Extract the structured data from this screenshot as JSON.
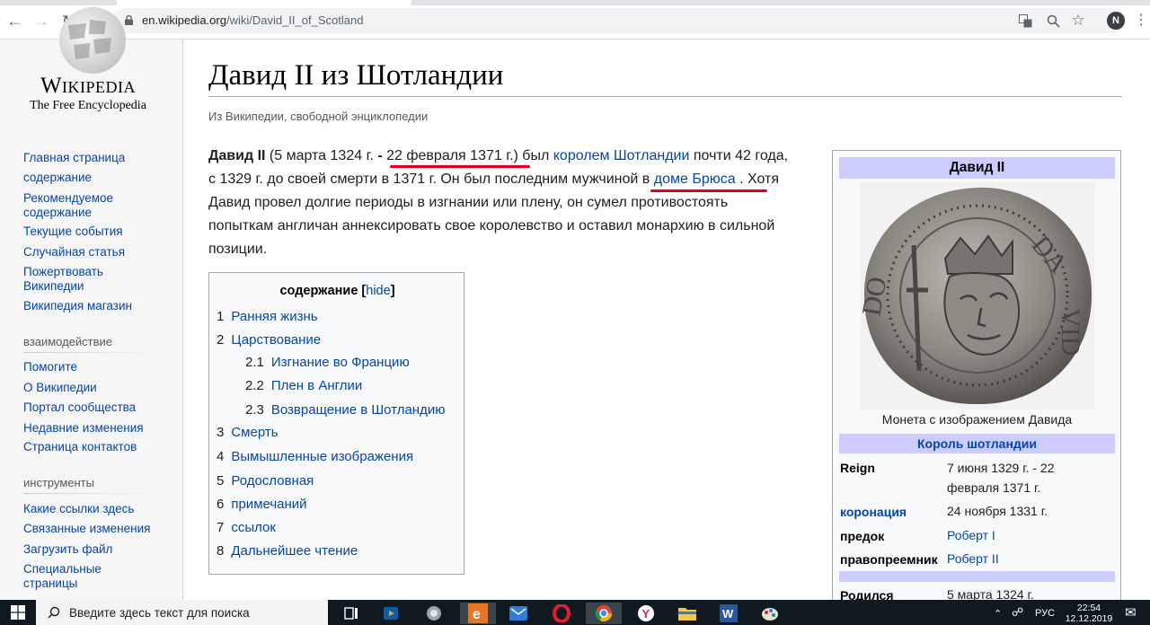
{
  "browser": {
    "url_host": "en.wikipedia.org",
    "url_path": "/wiki/David_II_of_Scotland",
    "profile_initial": "N"
  },
  "sidebar": {
    "logo_title": "Wikipedia",
    "logo_subtitle": "The Free Encyclopedia",
    "nav_links": [
      "Главная страница",
      "содержание",
      "Рекомендуемое содержание",
      "Текущие события",
      "Случайная статья",
      "Пожертвовать Википедии",
      "Википедия магазин"
    ],
    "interaction_heading": "взаимодействие",
    "interaction_links": [
      "Помогите",
      "О Википедии",
      "Портал сообщества",
      "Недавние изменения",
      "Страница контактов"
    ],
    "tools_heading": "инструменты",
    "tools_links": [
      "Какие ссылки здесь",
      "Связанные изменения",
      "Загрузить файл",
      "Специальные страницы"
    ]
  },
  "article": {
    "title": "Давид II из Шотландии",
    "subtitle": "Из Википедии, свободной энциклопедии",
    "lead": {
      "name": "Давид II",
      "dates_open": " (5 марта 1324 г. ",
      "dash": "-",
      "death_date": " 22 февраля 1371 г.",
      "dates_close": ")",
      "was": " был ",
      "king_link": "королем Шотландии",
      "line1_end": " почти 42 года,",
      "line2_start": "с 1329 г. до своей смерти в 1371 г. Он был последним мужчиной ",
      "line2_in": "в",
      "house_link": " доме Брюса",
      "line2_end": " . Хотя",
      "line3": "Давид провел долгие периоды в изгнании или плену, он сумел противостоять",
      "line4": "попыткам англичан аннексировать свое королевство и оставил монархию в сильной",
      "line5": "позиции."
    },
    "toc": {
      "title": "содержание",
      "hide_label": "hide",
      "items": [
        {
          "num": "1",
          "label": "Ранняя жизнь"
        },
        {
          "num": "2",
          "label": "Царствование"
        },
        {
          "num": "2.1",
          "label": "Изгнание во Францию"
        },
        {
          "num": "2.2",
          "label": "Плен в Англии"
        },
        {
          "num": "2.3",
          "label": "Возвращение в Шотландию"
        },
        {
          "num": "3",
          "label": "Смерть"
        },
        {
          "num": "4",
          "label": "Вымышленные изображения"
        },
        {
          "num": "5",
          "label": "Родословная"
        },
        {
          "num": "6",
          "label": "примечаний"
        },
        {
          "num": "7",
          "label": "ссылок"
        },
        {
          "num": "8",
          "label": "Дальнейшее чтение"
        }
      ]
    }
  },
  "infobox": {
    "title": "Давид II",
    "caption": "Монета с изображением Давида",
    "subheader": "Король шотландии",
    "rows": [
      {
        "label": "Reign",
        "value_line1": "7 июня 1329 г. - 22",
        "value_line2": "февраля 1371 г."
      },
      {
        "label": "коронация",
        "value": "24 ноября 1331 г."
      },
      {
        "label": "предок",
        "value": "Роберт I"
      },
      {
        "label": "правопреемник",
        "value": "Роберт II"
      },
      {
        "label": "Родился",
        "value": "5 марта 1324 г."
      }
    ]
  },
  "taskbar": {
    "search_placeholder": "Введите здесь текст для поиска",
    "lang": "РУС",
    "time": "22:54",
    "date": "12.12.2019"
  },
  "colors": {
    "link": "#0645ad",
    "infobox_header": "#ccccff",
    "annotation_red": "#e3001b",
    "taskbar": "#101820"
  }
}
